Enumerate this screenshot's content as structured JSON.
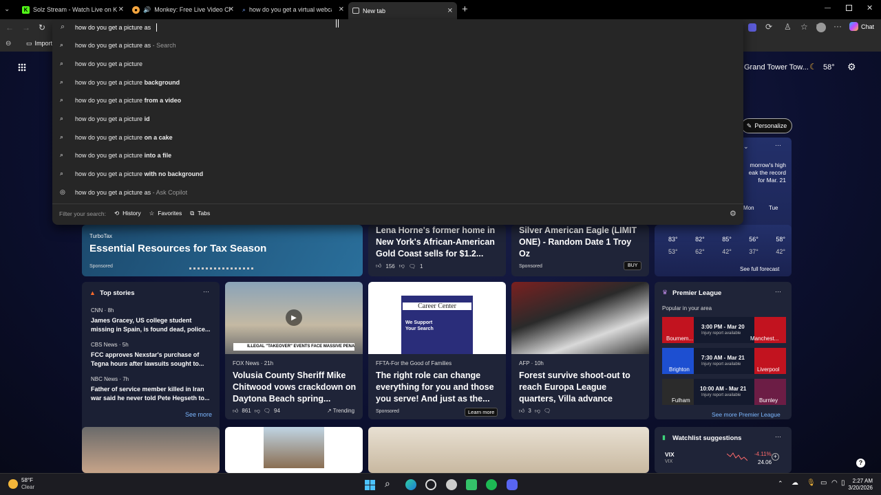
{
  "tabs": [
    {
      "label": "Solz Stream - Watch Live on K"
    },
    {
      "label": "Monkey: Free Live Video Chat"
    },
    {
      "label": "how do you get a virtual webcam"
    },
    {
      "label": "New tab"
    }
  ],
  "address": {
    "value": "how do you get a picture as "
  },
  "toolbar": {
    "chat_label": "Chat",
    "import_label": "Import"
  },
  "suggestions": [
    {
      "pre": "how do you get a picture as",
      "bold": "",
      "suffix": " - Search"
    },
    {
      "pre": "how do you get a picture",
      "bold": "",
      "suffix": ""
    },
    {
      "pre": "how do you get a picture ",
      "bold": "background",
      "suffix": ""
    },
    {
      "pre": "how do you get a picture ",
      "bold": "from a video",
      "suffix": ""
    },
    {
      "pre": "how do you get a picture ",
      "bold": "id",
      "suffix": ""
    },
    {
      "pre": "how do you get a picture ",
      "bold": "on a cake",
      "suffix": ""
    },
    {
      "pre": "how do you get a picture ",
      "bold": "into a file",
      "suffix": ""
    },
    {
      "pre": "how do you get a picture ",
      "bold": "with no background",
      "suffix": ""
    },
    {
      "pre": "how do you get a picture as",
      "bold": "",
      "suffix": " - Ask Copilot"
    }
  ],
  "filter": {
    "label": "Filter your search:",
    "history": "History",
    "favorites": "Favorites",
    "tabs": "Tabs"
  },
  "header": {
    "location": "Grand Tower Tow...",
    "temp": "58°",
    "personalize": "Personalize"
  },
  "weather_card": {
    "line1": "morrow's high",
    "line2": "eak the record",
    "line3": "for Mar. 21",
    "days": [
      {
        "day": "",
        "hi": "83°",
        "lo": "53°"
      },
      {
        "day": "",
        "hi": "82°",
        "lo": "62°"
      },
      {
        "day": "Mon",
        "hi": "85°",
        "lo": "42°"
      },
      {
        "day": "",
        "hi": "56°",
        "lo": "37°"
      },
      {
        "day": "Tue",
        "hi": "58°",
        "lo": "42°"
      }
    ],
    "forecast_link": "See full forecast"
  },
  "turbotax": {
    "brand": "TurboTax",
    "title": "Essential Resources for Tax Season",
    "sponsored": "Sponsored"
  },
  "lena": {
    "title": "Lena Horne's former home in New York's African-American Gold Coast sells for $1.2...",
    "likes": "156",
    "comments": "1"
  },
  "eagle": {
    "title": "Silver American Eagle (LIMIT ONE) - Random Date 1 Troy Oz",
    "sponsored": "Sponsored",
    "buy": "BUY"
  },
  "top_stories": {
    "header": "Top stories",
    "items": [
      {
        "source": "CNN · 8h",
        "title": "James Gracey, US college student missing in Spain, is found dead, police..."
      },
      {
        "source": "CBS News · 5h",
        "title": "FCC approves Nexstar's purchase of Tegna hours after lawsuits sought to..."
      },
      {
        "source": "NBC News · 7h",
        "title": "Father of service member killed in Iran war said he never told Pete Hegseth to..."
      }
    ],
    "see_more": "See more"
  },
  "foxnews": {
    "banner": "ILLEGAL \"TAKEOVER\" EVENTS FACE MASSIVE PENALTIES",
    "source": "FOX News · 21h",
    "title": "Volusia County Sheriff Mike Chitwood vows crackdown on Daytona Beach spring...",
    "likes": "861",
    "comments": "94",
    "trending": "Trending"
  },
  "ffta": {
    "img_label": "Career Center",
    "img_sub": "We Support Your Search",
    "source": "FFTA-For the Good of Families",
    "title": "The right role can change everything for you and those you serve! And just as the...",
    "sponsored": "Sponsored",
    "learn": "Learn more"
  },
  "afp": {
    "source": "AFP · 10h",
    "title": "Forest survive shoot-out to reach Europa League quarters, Villa advance",
    "likes": "3"
  },
  "premier": {
    "header": "Premier League",
    "popular": "Popular in your area",
    "matches": [
      {
        "home": "Bournem...",
        "time": "3:00 PM - Mar 20",
        "note": "Injury report available",
        "away": "Manchest..."
      },
      {
        "home": "Brighton",
        "time": "7:30 AM - Mar 21",
        "note": "Injury report available",
        "away": "Liverpool"
      },
      {
        "home": "Fulham",
        "time": "10:00 AM - Mar 21",
        "note": "Injury report available",
        "away": "Burnley"
      }
    ],
    "see_more": "See more Premier League"
  },
  "watchlist": {
    "header": "Watchlist suggestions",
    "symbol": "VIX",
    "sub": "VIX",
    "change": "-4.11%",
    "price": "24.06"
  },
  "taskbar": {
    "weather_temp": "58°F",
    "weather_desc": "Clear",
    "time": "2:27 AM",
    "date": "3/20/2026"
  }
}
